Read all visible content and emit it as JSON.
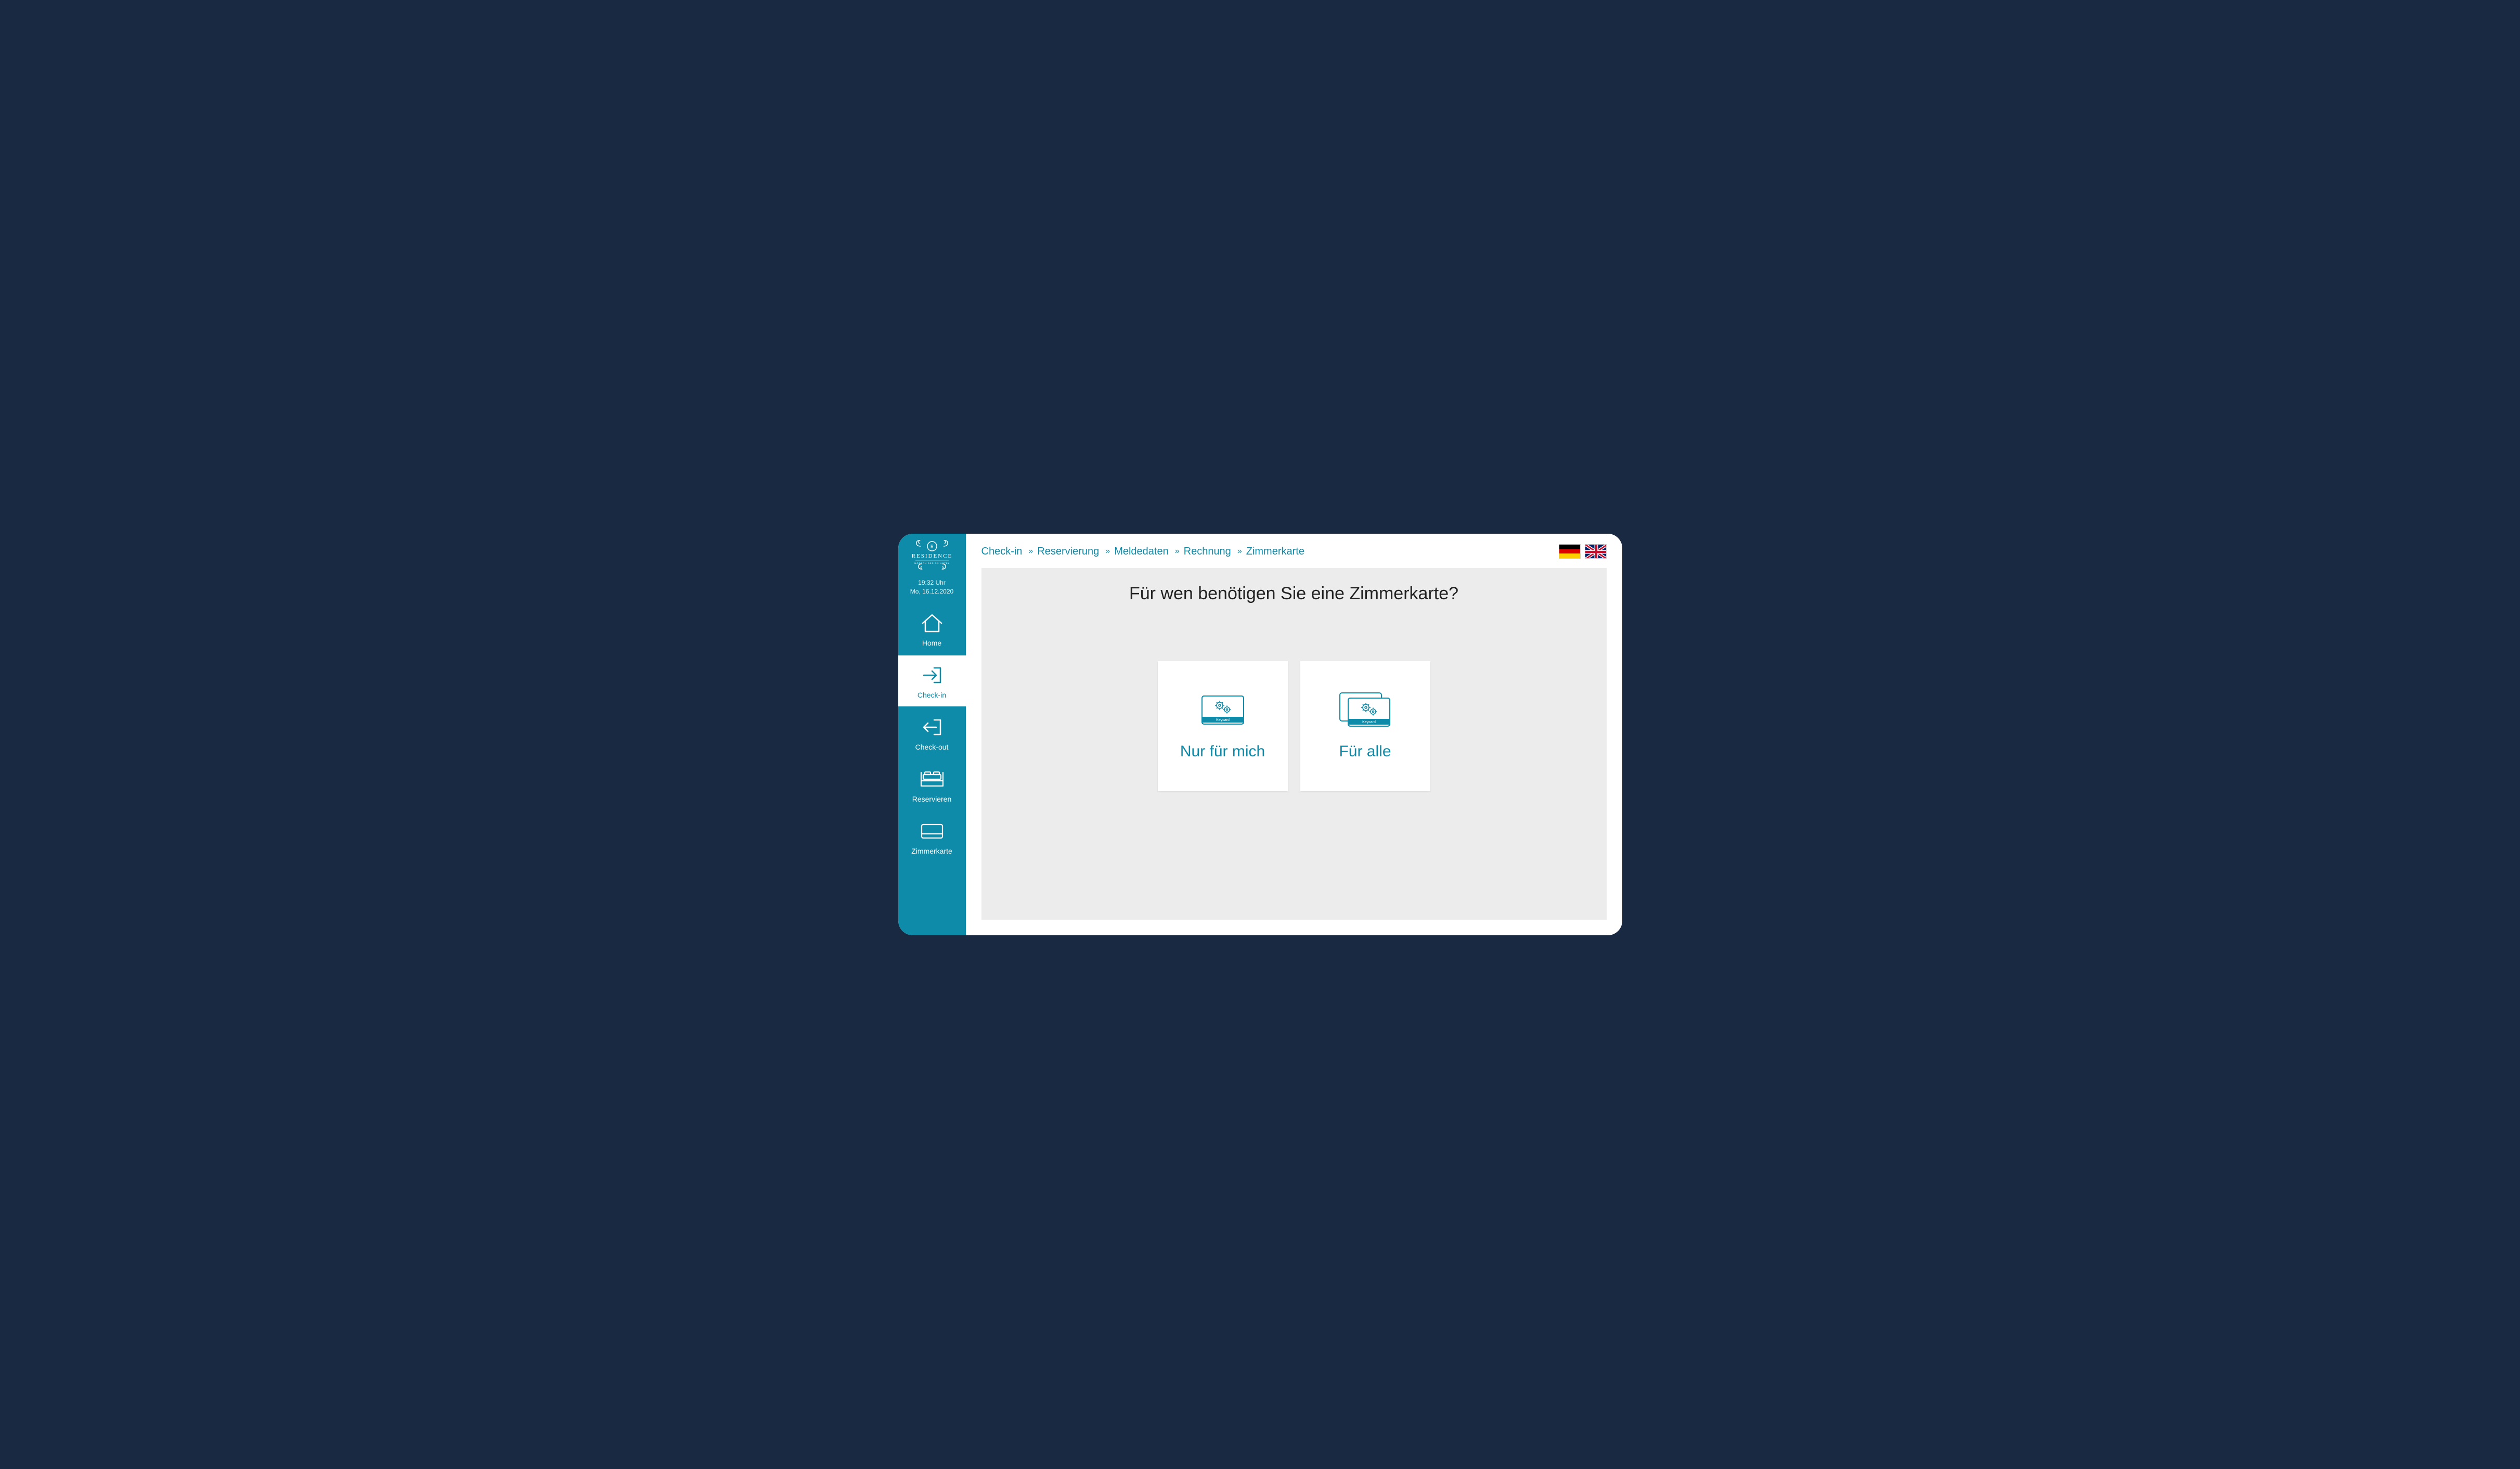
{
  "brand": {
    "name": "RESIDENCE"
  },
  "clock": {
    "time": "19:32 Uhr",
    "date": "Mo, 16.12.2020"
  },
  "sidebar": {
    "items": [
      {
        "id": "home",
        "label": "Home"
      },
      {
        "id": "checkin",
        "label": "Check-in"
      },
      {
        "id": "checkout",
        "label": "Check-out"
      },
      {
        "id": "reservieren",
        "label": "Reservieren"
      },
      {
        "id": "zimmerkarte",
        "label": "Zimmerkarte"
      }
    ],
    "active": "checkin"
  },
  "breadcrumb": [
    "Check-in",
    "Reservierung",
    "Meldedaten",
    "Rechnung",
    "Zimmerkarte"
  ],
  "languages": {
    "de": "Deutsch",
    "en": "English"
  },
  "main": {
    "question": "Für wen benötigen Sie eine Zimmerkarte?",
    "options": [
      {
        "id": "self",
        "label": "Nur für mich",
        "keycard_text": "Keycard"
      },
      {
        "id": "all",
        "label": "Für alle",
        "keycard_text": "Keycard"
      }
    ]
  },
  "colors": {
    "accent": "#0e8ba8",
    "frame": "#1a2942",
    "panel": "#ececec"
  }
}
